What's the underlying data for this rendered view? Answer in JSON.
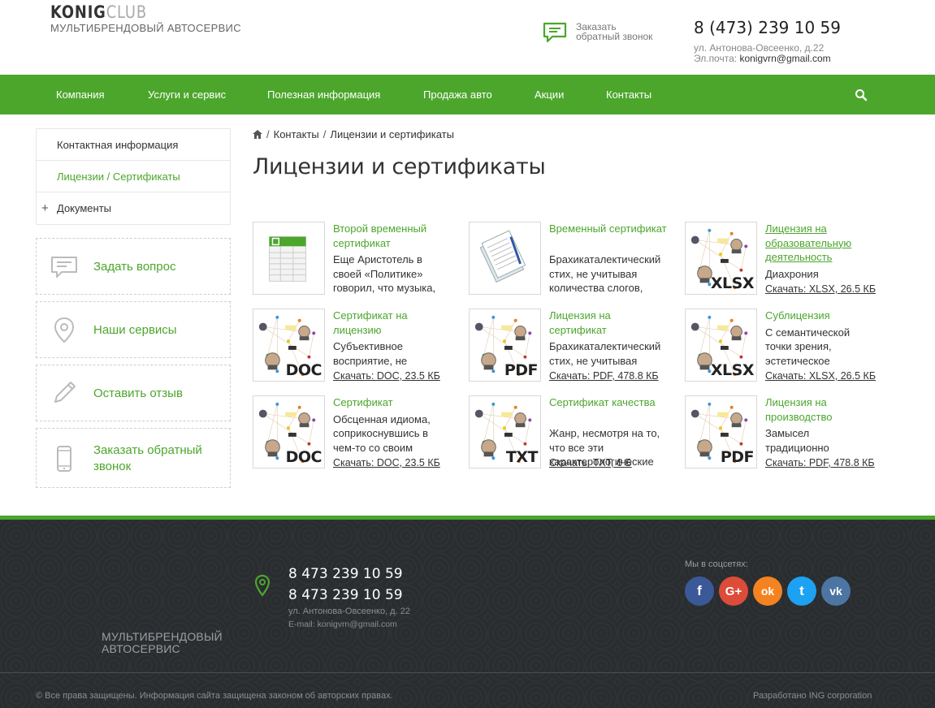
{
  "header": {
    "logo_main": "KONIG",
    "logo_accent": "CLUB",
    "tagline": "МУЛЬТИБРЕНДОВЫЙ АВТОСЕРВИС",
    "callback_line1": "Заказать",
    "callback_line2": "обратный звонок",
    "phone": "8 (473) 239 10 59",
    "address": "ул. Антонова-Овсеенко, д.22",
    "email_label": "Эл.почта: ",
    "email": "konigvrn@gmail.com"
  },
  "nav": {
    "items": [
      "Компания",
      "Услуги и сервис",
      "Полезная информация",
      "Продажа авто",
      "Акции",
      "Контакты"
    ],
    "search_icon": "search-icon"
  },
  "sidebar": {
    "menu": [
      "Контактная информация",
      "Лицензии / Сертификаты",
      "Документы"
    ],
    "boxes": [
      {
        "label": "Задать вопрос",
        "icon": "chat-icon"
      },
      {
        "label": "Наши сервисы",
        "icon": "location-pin-icon"
      },
      {
        "label": "Оставить отзыв",
        "icon": "pencil-icon"
      },
      {
        "label": "Заказать обратный звонок",
        "icon": "phone-icon"
      }
    ]
  },
  "breadcrumb": {
    "home_icon": "home-icon",
    "items": [
      "Контакты",
      "Лицензии и сертификаты"
    ]
  },
  "page_title": "Лицензии и сертификаты",
  "documents": [
    {
      "title": "Второй временный сертификат",
      "desc": [
        "Еще Аристотель в",
        "своей «Политике»",
        "говорил, что музыка,"
      ],
      "download": "",
      "ext": "",
      "thumb": "spreadsheet-icon"
    },
    {
      "title": "Временный сертификат",
      "desc": [
        "Брахикаталектический",
        "стих, не учитывая",
        "количества слогов,"
      ],
      "download": "",
      "ext": "",
      "thumb": "documents-icon"
    },
    {
      "title": "Лицензия на образовательную деятельность",
      "desc": [
        "Диахрония"
      ],
      "download": "Скачать: XLSX, 26.5 КБ",
      "ext": "XLSX",
      "thumb": "file-preview-image"
    },
    {
      "title": "Сертификат на лицензию",
      "desc": [
        "Субъективное",
        "восприятие, не"
      ],
      "download": "Скачать: DOC, 23.5 КБ",
      "ext": "DOC",
      "thumb": "file-preview-image"
    },
    {
      "title": "Лицензия на сертификат",
      "desc": [
        "Брахикаталектический",
        "стих, не учитывая"
      ],
      "download": "Скачать: PDF, 478.8 КБ",
      "ext": "PDF",
      "thumb": "file-preview-image"
    },
    {
      "title": "Сублицензия",
      "desc": [
        "С семантической",
        "точки зрения,",
        "эстетическое"
      ],
      "download": "Скачать: XLSX, 26.5 КБ",
      "ext": "XLSX",
      "thumb": "file-preview-image"
    },
    {
      "title": "Сертификат",
      "desc": [
        "Обсценная идиома,",
        "соприкоснувшись в",
        "чем-то со своим"
      ],
      "download": "Скачать: DOC, 23.5 КБ",
      "ext": "DOC",
      "thumb": "file-preview-image"
    },
    {
      "title": "Сертификат качества",
      "desc": [
        "Жанр, несмотря на то,",
        "что все эти",
        "характерологические"
      ],
      "download": "Скачать: TXT, 6 Б",
      "ext": "TXT",
      "thumb": "file-preview-image"
    },
    {
      "title": "Лицензия на производство",
      "desc": [
        "Замысел",
        "традиционно"
      ],
      "download": "Скачать: PDF, 478.8 КБ",
      "ext": "PDF",
      "thumb": "file-preview-image"
    }
  ],
  "footer": {
    "tagline_line1": "МУЛЬТИБРЕНДОВЫЙ",
    "tagline_line2": "АВТОСЕРВИС",
    "phone1": "8 473 239 10 59",
    "phone2": "8 473 239 10 59",
    "address": "ул. Антонова-Овсеенко, д. 22",
    "email": "E-mail: konigvrn@gmail.com",
    "social_label": "Мы в соцсетях:",
    "social": [
      {
        "name": "facebook",
        "glyph": "f",
        "color": "#3b5998"
      },
      {
        "name": "google-plus",
        "glyph": "G+",
        "color": "#dd4b39"
      },
      {
        "name": "odnoklassniki",
        "glyph": "ok",
        "color": "#f58220"
      },
      {
        "name": "twitter",
        "glyph": "t",
        "color": "#1da1f2"
      },
      {
        "name": "vkontakte",
        "glyph": "vk",
        "color": "#4c75a3"
      }
    ],
    "copyright": "© Все права защищены. Информация сайта защищена законом об авторских правах.",
    "developer": "Разработано ING corporation"
  },
  "colors": {
    "accent": "#4ca62c",
    "footer_bg": "#2a2d30"
  }
}
